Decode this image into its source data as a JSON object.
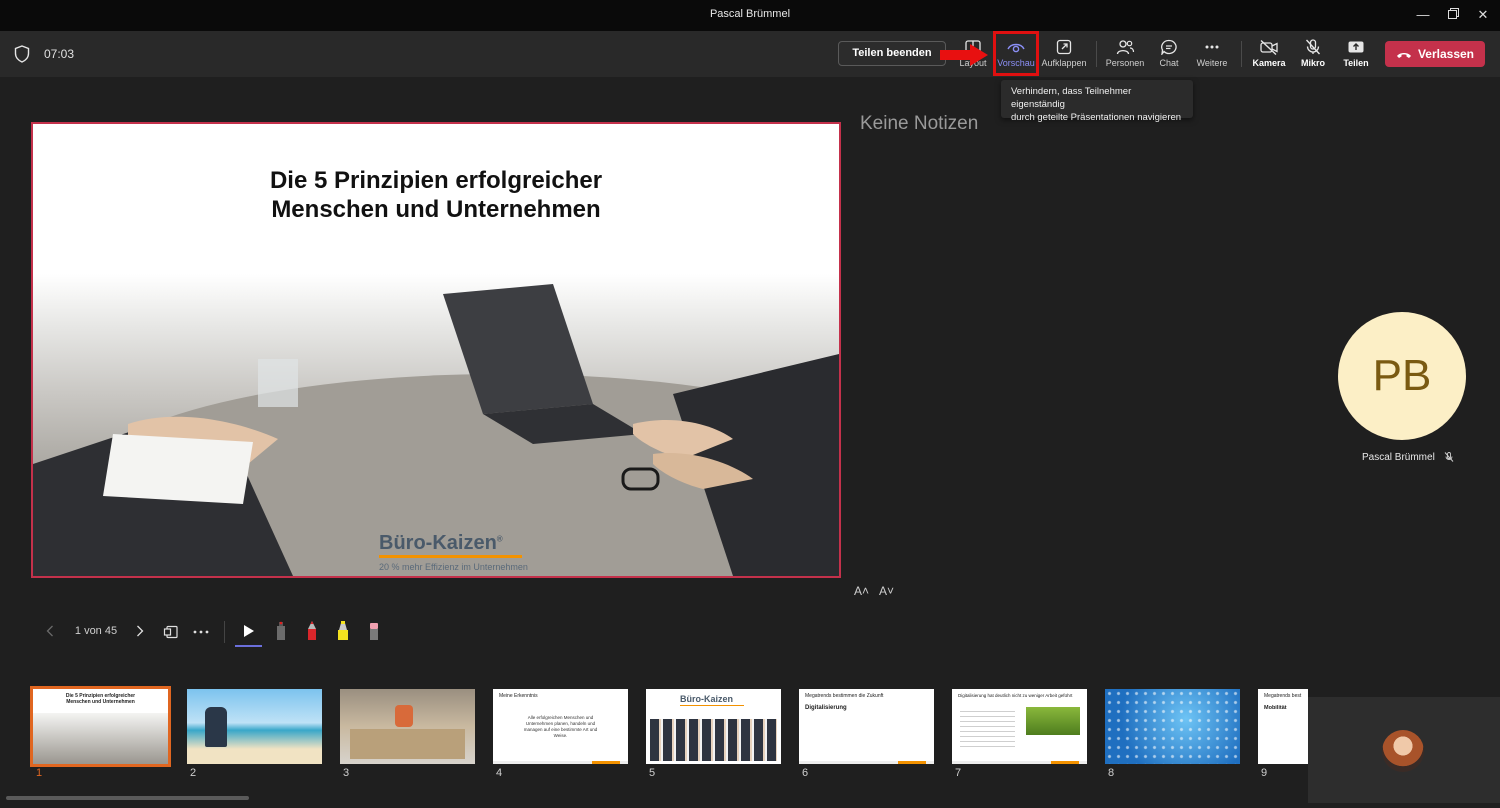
{
  "window": {
    "title": "Pascal Brümmel"
  },
  "meeting": {
    "timer": "07:03"
  },
  "toolbar": {
    "stop_sharing": "Teilen beenden",
    "layout": "Layout",
    "preview": "Vorschau",
    "popout": "Aufklappen",
    "people": "Personen",
    "chat": "Chat",
    "more": "Weitere",
    "camera": "Kamera",
    "mic": "Mikro",
    "share": "Teilen",
    "leave": "Verlassen"
  },
  "tooltip": {
    "line1": "Verhindern, dass Teilnehmer eigenständig",
    "line2": "durch geteilte Präsentationen navigieren"
  },
  "slide": {
    "title_line1": "Die 5 Prinzipien erfolgreicher",
    "title_line2": "Menschen und Unternehmen",
    "brand": "Büro-Kaizen",
    "brand_mark": "®",
    "brand_tagline": "20 % mehr Effizienz im Unternehmen"
  },
  "notes": {
    "empty_text": "Keine Notizen",
    "font_up": "A˄",
    "font_down": "A˅"
  },
  "participant": {
    "initials": "PB",
    "name": "Pascal Brümmel"
  },
  "navigation": {
    "page_indicator": "1 von 45"
  },
  "thumbnails": [
    {
      "num": "1",
      "selected": true,
      "title": "Die 5 Prinzipien erfolgreicher\nMenschen und Unternehmen"
    },
    {
      "num": "2"
    },
    {
      "num": "3"
    },
    {
      "num": "4",
      "title": "Meine Erkenntnis",
      "body": "Alle erfolgreichen Menschen und Unternehmen planen, handeln und managen auf eine bestimmte Art und Weise."
    },
    {
      "num": "5",
      "title": "Büro-Kaizen"
    },
    {
      "num": "6",
      "title": "Megatrends bestimmen die Zukunft",
      "body": "Digitalisierung"
    },
    {
      "num": "7",
      "title": "Digitalisierung hat deutlich nicht zu weniger Arbeit geführt"
    },
    {
      "num": "8"
    },
    {
      "num": "9",
      "title": "Megatrends best",
      "body": "Mobilität"
    }
  ]
}
